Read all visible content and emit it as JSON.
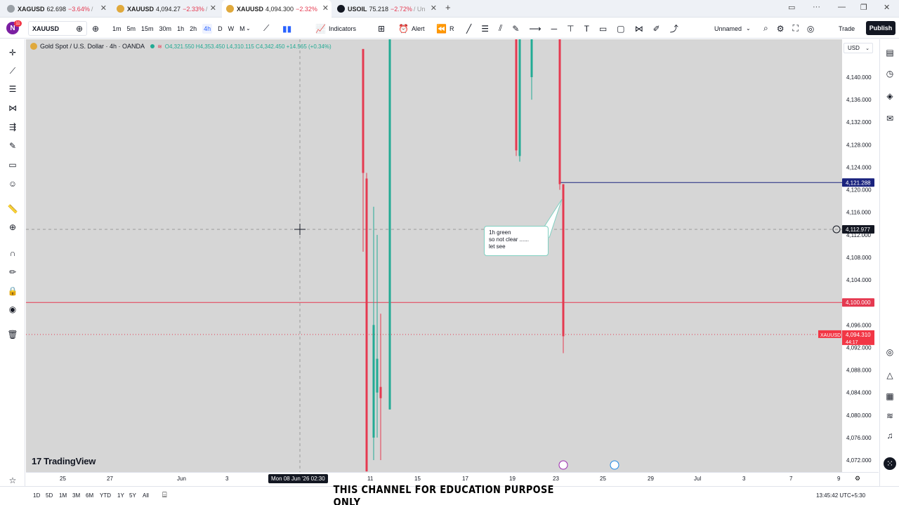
{
  "browser": {
    "tabs": [
      {
        "symbol": "XAGUSD",
        "price": "62.698",
        "change": "−3.64%",
        "more": "/",
        "icon_color": "#9aa0a6",
        "active": false
      },
      {
        "symbol": "XAUUSD",
        "price": "4,094.27",
        "change": "−2.33%",
        "more": "/",
        "icon_color": "#e0a93c",
        "active": false
      },
      {
        "symbol": "XAUUSD",
        "price": "4,094.300",
        "change": "−2.32%",
        "more": "",
        "icon_color": "#e0a93c",
        "active": true
      },
      {
        "symbol": "USOIL",
        "price": "75.218",
        "change": "−2.72%",
        "more": "/ Un",
        "icon_color": "#131722",
        "active": false
      }
    ],
    "new_tab": "+"
  },
  "toolbar": {
    "avatar_letter": "N",
    "avatar_badge": "11",
    "symbol": "XAUUSD",
    "timeframes": [
      "1m",
      "5m",
      "15m",
      "30m",
      "1h",
      "2h",
      "4h",
      "D",
      "W",
      "M"
    ],
    "active_timeframe": "4h",
    "indicators_label": "Indicators",
    "alert_label": "Alert",
    "replay_label": "R",
    "layout_name": "Unnamed",
    "trade_label": "Trade",
    "publish_label": "Publish"
  },
  "legend": {
    "title": "Gold Spot / U.S. Dollar · 4h · OANDA",
    "ohlc": "O4,321.550  H4,353.450  L4,310.115  C4,342.450  +14.565 (+0.34%)"
  },
  "currency": "USD",
  "note_text": "1h green\nso not clear ......\nlet see",
  "branding": "TradingView",
  "price_axis": {
    "labels": [
      "4,140.000",
      "4,136.000",
      "4,132.000",
      "4,128.000",
      "4,124.000",
      "4,120.000",
      "4,116.000",
      "4,112.000",
      "4,108.000",
      "4,104.000",
      "4,100.000",
      "4,096.000",
      "4,092.000",
      "4,088.000",
      "4,084.000",
      "4,080.000",
      "4,076.000",
      "4,072.000"
    ],
    "values": [
      4140,
      4136,
      4132,
      4128,
      4124,
      4120,
      4116,
      4112,
      4108,
      4104,
      4100,
      4096,
      4092,
      4088,
      4084,
      4080,
      4076,
      4072
    ],
    "badges": [
      {
        "label": "4,121.288",
        "value": 4121.288,
        "color": "#1a237e"
      },
      {
        "label": "4,112.977",
        "value": 4112.977,
        "color": "#131722"
      },
      {
        "label": "4,100.000",
        "value": 4100.0,
        "color": "#e53950"
      }
    ],
    "last_price": {
      "symbol": "XAUUSD",
      "price": "4,094.310",
      "countdown": "44:17",
      "value": 4094.31,
      "color": "#f23645"
    }
  },
  "time_axis": {
    "ticks": [
      "25",
      "27",
      "Jun",
      "3",
      "11",
      "15",
      "17",
      "19",
      "23",
      "25",
      "29",
      "Jul",
      "3",
      "7",
      "9"
    ],
    "crosshair_label": "Mon 08 Jun '26   02:30"
  },
  "horizontal_lines": [
    {
      "value": 4121.288,
      "color": "#1a237e"
    },
    {
      "value": 4100.0,
      "color": "#e53950"
    }
  ],
  "candles": [
    {
      "color": "#e53950",
      "high": 4145,
      "low": 4109,
      "open": 4145,
      "close": 4123,
      "k": 0
    },
    {
      "color": "#e53950",
      "high": 4123,
      "low": 4070,
      "open": 4122,
      "close": 4070,
      "k": 1
    },
    {
      "color": "#22ab94",
      "high": 4117,
      "low": 4072,
      "open": 4076,
      "close": 4096,
      "k": 2
    },
    {
      "color": "#22ab94",
      "high": 4112,
      "low": 4076,
      "open": 4084,
      "close": 4090,
      "k": 3
    },
    {
      "color": "#e53950",
      "high": 4098,
      "low": 4072,
      "open": 4085,
      "close": 4083,
      "k": 4
    },
    {
      "color": "#22ab94",
      "high": 4150,
      "low": 4081,
      "open": 4081,
      "close": 4150,
      "k": 5
    },
    {
      "color": "#e53950",
      "high": 4150,
      "low": 4126,
      "open": 4150,
      "close": 4127,
      "k": 6
    },
    {
      "color": "#22ab94",
      "high": 4150,
      "low": 4125,
      "open": 4126,
      "close": 4148,
      "k": 7
    },
    {
      "color": "#22ab94",
      "high": 4150,
      "low": 4136,
      "open": 4140,
      "close": 4148,
      "k": 8
    },
    {
      "color": "#e53950",
      "high": 4150,
      "low": 4120,
      "open": 4150,
      "close": 4121,
      "k": 9
    },
    {
      "color": "#e53950",
      "high": 4121,
      "low": 4091,
      "open": 4121,
      "close": 4094,
      "k": 10
    }
  ],
  "bottom": {
    "ranges": [
      "1D",
      "5D",
      "1M",
      "3M",
      "6M",
      "YTD",
      "1Y",
      "5Y",
      "All"
    ],
    "clock": "13:45:42 UTC+5:30",
    "banner": "THIS CHANNEL FOR EDUCATION PURPOSE ONLY"
  }
}
